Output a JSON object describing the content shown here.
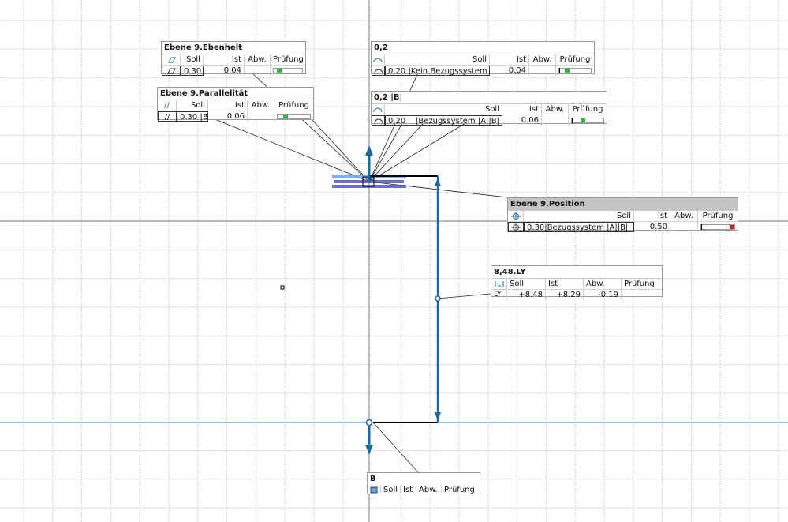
{
  "colors": {
    "grid": "#d3d3d3",
    "axis": "#777777",
    "datum_line": "#8fc8ec",
    "feature_blue": "#1a6aa0",
    "pass_green": "#2bb83c",
    "fail_red": "#c82828"
  },
  "headers": {
    "soll": "Soll",
    "ist": "Ist",
    "abw": "Abw.",
    "pruefung": "Prüfung"
  },
  "callouts": {
    "ebenheit": {
      "title": "Ebene 9.Ebenheit",
      "icon": "flatness-icon",
      "soll": "0.30",
      "ist": "0.04",
      "abw": "",
      "check": "pass",
      "check_fraction": 0.13
    },
    "parallelitaet": {
      "title": "Ebene 9.Parallelität",
      "icon": "parallelism-icon",
      "icon_text": "//",
      "header_icon_text": "//",
      "soll": "0.30 |B",
      "ist": "0.06",
      "abw": "",
      "check": "pass",
      "check_fraction": 0.2
    },
    "profile1": {
      "title": "0,2",
      "icon": "surface-profile-icon",
      "soll": "0.20 |Kein Bezugssystem",
      "ist": "0.04",
      "abw": "",
      "check": "pass",
      "check_fraction": 0.2
    },
    "profile2": {
      "title": "0,2 |B|",
      "icon": "surface-profile-icon",
      "soll": "0.20    |Bezugssystem |A||B|",
      "ist": "0.06",
      "abw": "",
      "check": "pass",
      "check_fraction": 0.3
    },
    "position": {
      "title": "Ebene 9.Position",
      "icon": "position-icon",
      "soll": "0.30|Bezugssystem |A||B|",
      "ist": "0.50",
      "abw": "",
      "check": "fail",
      "check_fraction": 1.0
    },
    "distance": {
      "title": "8,48.LY",
      "icon": "distance-icon",
      "label": "LY'",
      "soll": "+8.48",
      "ist": "+8.29",
      "abw": "-0.19",
      "check": ""
    },
    "datum_b": {
      "title": "B",
      "icon": "datum-icon"
    }
  }
}
